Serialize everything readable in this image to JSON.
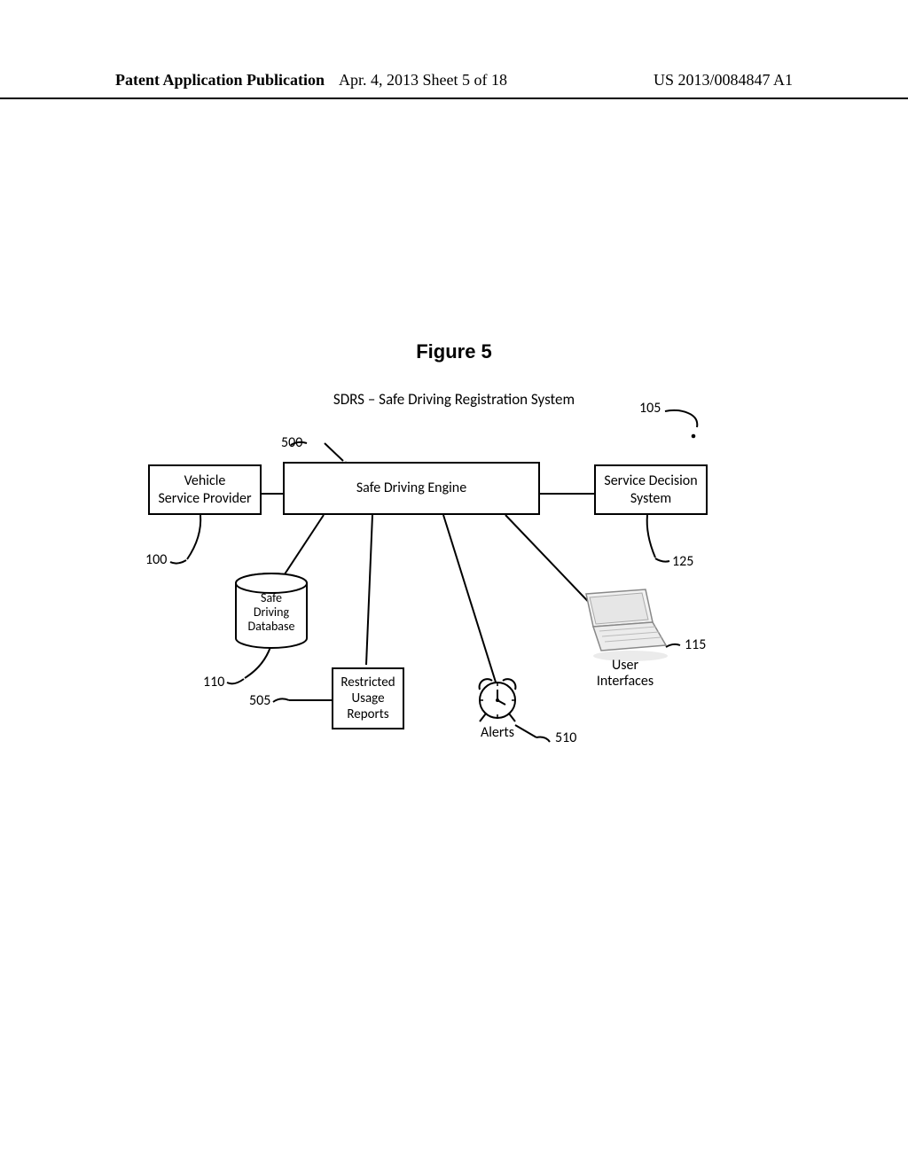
{
  "header": {
    "left": "Patent Application Publication",
    "center": "Apr. 4, 2013  Sheet 5 of 18",
    "right": "US 2013/0084847 A1"
  },
  "figure": {
    "title": "Figure 5",
    "subtitle": "SDRS – Safe Driving Registration System"
  },
  "nodes": {
    "vehicle_provider": "Vehicle\nService Provider",
    "engine": "Safe Driving Engine",
    "decision": "Service Decision\nSystem",
    "database": "Safe\nDriving\nDatabase",
    "reports": "Restricted\nUsage\nReports",
    "alerts": "Alerts",
    "ui": "User\nInterfaces"
  },
  "refs": {
    "r100": "100",
    "r105": "105",
    "r110": "110",
    "r115": "115",
    "r125": "125",
    "r500": "500",
    "r505": "505",
    "r510": "510"
  }
}
